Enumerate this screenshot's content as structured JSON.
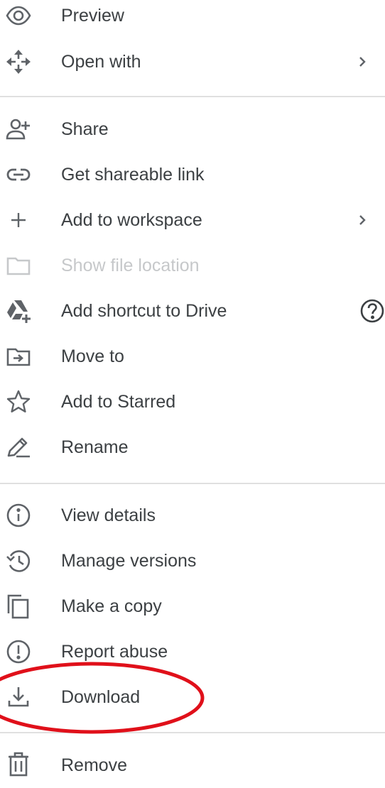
{
  "menu": {
    "items": [
      {
        "label": "Preview",
        "icon": "eye-icon"
      },
      {
        "label": "Open with",
        "icon": "move-arrows-icon",
        "submenu": true
      },
      {
        "label": "Share",
        "icon": "person-add-icon"
      },
      {
        "label": "Get shareable link",
        "icon": "link-icon"
      },
      {
        "label": "Add to workspace",
        "icon": "plus-icon",
        "submenu": true
      },
      {
        "label": "Show file location",
        "icon": "folder-icon",
        "disabled": true
      },
      {
        "label": "Add shortcut to Drive",
        "icon": "drive-shortcut-icon",
        "help": true
      },
      {
        "label": "Move to",
        "icon": "move-to-folder-icon"
      },
      {
        "label": "Add to Starred",
        "icon": "star-icon"
      },
      {
        "label": "Rename",
        "icon": "pencil-icon"
      },
      {
        "label": "View details",
        "icon": "info-icon"
      },
      {
        "label": "Manage versions",
        "icon": "history-icon"
      },
      {
        "label": "Make a copy",
        "icon": "copy-icon"
      },
      {
        "label": "Report abuse",
        "icon": "alert-icon"
      },
      {
        "label": "Download",
        "icon": "download-icon",
        "highlighted": true
      },
      {
        "label": "Remove",
        "icon": "trash-icon"
      }
    ]
  },
  "colors": {
    "text": "#3c4043",
    "icon": "#5f6368",
    "disabled": "#c6c8ca",
    "divider": "#e0e0e0",
    "annotation": "#e0101a"
  }
}
